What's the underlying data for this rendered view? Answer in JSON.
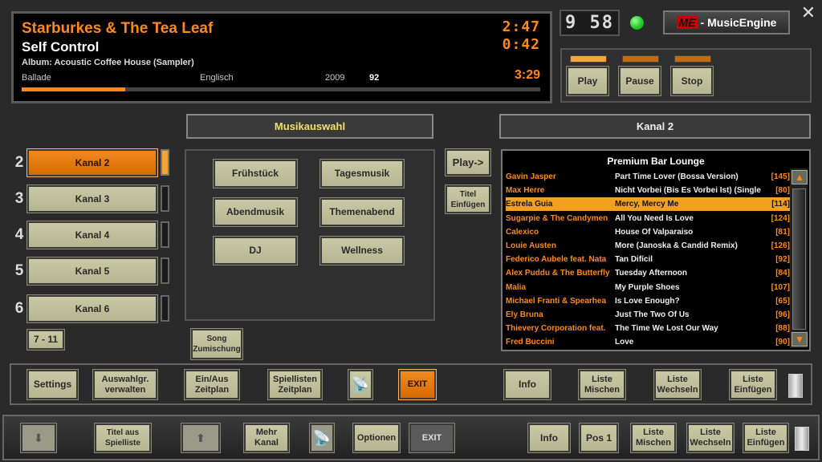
{
  "now_playing": {
    "artist": "Starburkes & The Tea Leaf",
    "title": "Self Control",
    "album": "Album: Acoustic Coffee House (Sampler)",
    "genre": "Ballade",
    "language": "Englisch",
    "year": "2009",
    "bpm": "92",
    "elapsed": "2:47",
    "remaining": "0:42",
    "duration": "3:29",
    "progress": 0.2
  },
  "clock": "9 58",
  "brand": {
    "me": "ME",
    "name": "- MusicEngine"
  },
  "close_label": "✕",
  "controls": {
    "play": "Play",
    "pause": "Pause",
    "stop": "Stop"
  },
  "channels": [
    {
      "num": "2",
      "label": "Kanal 2",
      "active": true
    },
    {
      "num": "3",
      "label": "Kanal 3",
      "active": false
    },
    {
      "num": "4",
      "label": "Kanal 4",
      "active": false
    },
    {
      "num": "5",
      "label": "Kanal 5",
      "active": false
    },
    {
      "num": "6",
      "label": "Kanal 6",
      "active": false
    }
  ],
  "more_channels": "7 - 11",
  "musikauswahl": {
    "header": "Musikauswahl",
    "buttons": [
      "Frühstück",
      "Tagesmusik",
      "Abendmusik",
      "Themenabend",
      "DJ",
      "Wellness"
    ]
  },
  "song_mix": "Song Zumischung",
  "play_to": "Play->",
  "insert_title": "Titel Einfügen",
  "kanal_header": "Kanal 2",
  "playlist": {
    "name": "Premium Bar Lounge",
    "rows": [
      {
        "artist": "Gavin Jasper",
        "song": "Part Time Lover (Bossa Version)",
        "bpm": "[145]"
      },
      {
        "artist": "Max Herre",
        "song": "Nicht Vorbei (Bis Es Vorbei Ist) (Single",
        "bpm": "[80]"
      },
      {
        "artist": "Estrela Guia",
        "song": "Mercy, Mercy Me",
        "bpm": "[114]"
      },
      {
        "artist": "Sugarpie & The Candymen",
        "song": "All You Need Is Love",
        "bpm": "[124]"
      },
      {
        "artist": "Calexico",
        "song": "House Of Valparaiso",
        "bpm": "[81]"
      },
      {
        "artist": "Louie Austen",
        "song": "More (Janoska & Candid Remix)",
        "bpm": "[126]"
      },
      {
        "artist": "Federico Aubele feat. Nata",
        "song": "Tan Difícil",
        "bpm": "[92]"
      },
      {
        "artist": "Alex Puddu & The Butterfly",
        "song": "Tuesday Afternoon",
        "bpm": "[84]"
      },
      {
        "artist": "Malia",
        "song": "My Purple Shoes",
        "bpm": "[107]"
      },
      {
        "artist": "Michael Franti & Spearhea",
        "song": "Is Love Enough?",
        "bpm": "[65]"
      },
      {
        "artist": "Ely Bruna",
        "song": "Just The Two Of Us",
        "bpm": "[96]"
      },
      {
        "artist": "Thievery Corporation feat.",
        "song": "The Time We Lost Our Way",
        "bpm": "[88]"
      },
      {
        "artist": "Fred Buccini",
        "song": "Love",
        "bpm": "[90]"
      }
    ],
    "selected_index": 2
  },
  "toolbar1": {
    "settings": "Settings",
    "groups": "Auswahlgr. verwalten",
    "onoff": "Ein/Aus Zeitplan",
    "playlists": "Spiellisten Zeitplan",
    "exit": "EXIT",
    "info": "Info",
    "mix": "Liste Mischen",
    "swap": "Liste Wechseln",
    "insert": "Liste Einfügen"
  },
  "toolbar2": {
    "down": "⬇",
    "from_list": "Titel aus Spielliste",
    "up": "⬆",
    "more_channel": "Mehr Kanal",
    "options": "Optionen",
    "exit": "EXIT",
    "info": "Info",
    "pos1": "Pos 1",
    "mix": "Liste Mischen",
    "swap": "Liste Wechseln",
    "insert": "Liste Einfügen"
  },
  "colors": {
    "accent": "#ff8a1a",
    "button": "#c2c2a0",
    "background": "#2a2a2a"
  }
}
